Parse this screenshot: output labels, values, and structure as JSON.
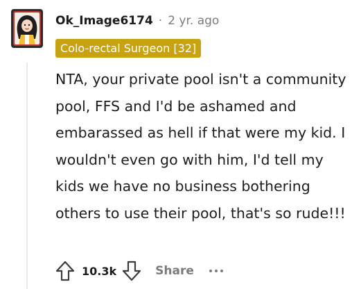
{
  "comment": {
    "username": "Ok_Image6174",
    "separator": "·",
    "age": "2 yr. ago",
    "flair": "Colo-rectal Surgeon [32]",
    "body": "NTA, your private pool isn't a community pool, FFS and I'd be ashamed and embarassed as hell if that were my kid. I wouldn't even go with him, I'd tell my kids we have no business bothering others to use their pool, that's so rude!!!",
    "score": "10.3k",
    "share_label": "Share"
  },
  "colors": {
    "flair_bg": "#c9a30f",
    "flair_text": "#ffffff",
    "meta_text": "#7c7c7c",
    "thread_line": "#e6e8ea"
  },
  "icons": [
    "avatar",
    "upvote-icon",
    "downvote-icon",
    "more-options-icon"
  ]
}
